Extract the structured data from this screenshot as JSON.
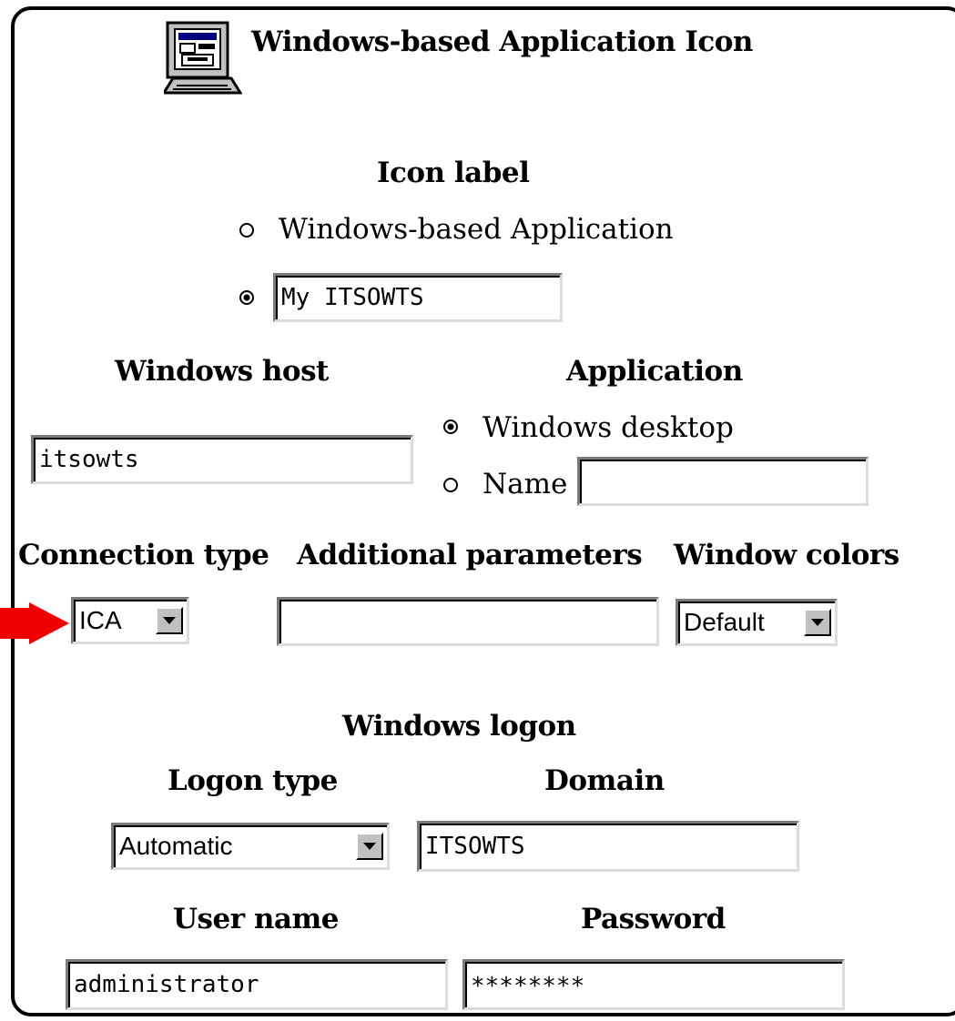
{
  "header": {
    "title": "Windows-based Application Icon",
    "icon": "monitor-app-icon"
  },
  "icon_label": {
    "heading": "Icon label",
    "option_default": "Windows-based Application",
    "custom_value": "My ITSOWTS",
    "selected": "custom"
  },
  "windows_host": {
    "heading": "Windows host",
    "value": "itsowts"
  },
  "application": {
    "heading": "Application",
    "option_desktop": "Windows desktop",
    "option_name": "Name",
    "name_value": "",
    "selected": "desktop"
  },
  "connection_type": {
    "heading": "Connection type",
    "value": "ICA"
  },
  "additional_parameters": {
    "heading": "Additional parameters",
    "value": ""
  },
  "window_colors": {
    "heading": "Window colors",
    "value": "Default"
  },
  "windows_logon": {
    "heading": "Windows logon",
    "logon_type": {
      "heading": "Logon type",
      "value": "Automatic"
    },
    "domain": {
      "heading": "Domain",
      "value": "ITSOWTS"
    },
    "user_name": {
      "heading": "User name",
      "value": "administrator"
    },
    "password": {
      "heading": "Password",
      "value": "********"
    }
  },
  "annotation": {
    "arrow_color": "#ee0000",
    "points_to": "connection-type-select"
  }
}
